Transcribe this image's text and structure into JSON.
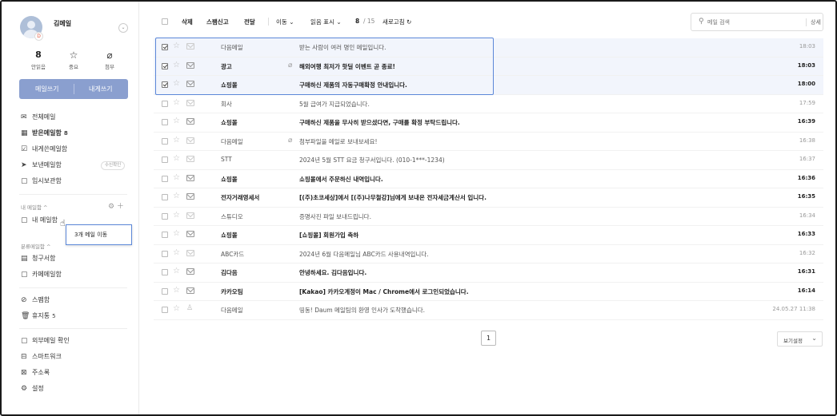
{
  "profile": {
    "name": "김메일",
    "toggle_icon": "chevron-down-icon"
  },
  "stats": [
    {
      "value": "8",
      "label": "안읽음"
    },
    {
      "icon": "☆",
      "label": "중요"
    },
    {
      "icon": "⌀",
      "label": "첨부"
    }
  ],
  "compose": {
    "write": "메일쓰기",
    "write_self": "내게쓰기"
  },
  "nav": [
    {
      "icon": "✉",
      "label": "전체메일"
    },
    {
      "icon": "▦",
      "label": "받은메일함",
      "badge": "8"
    },
    {
      "icon": "☑",
      "label": "내게쓴메일함"
    },
    {
      "icon": "➤",
      "label": "보낸메일함",
      "pill": "수신확인"
    },
    {
      "icon": "▢",
      "label": "임시보관함"
    }
  ],
  "my_folders": {
    "header": "내 메일함 ^",
    "items": [
      {
        "label": "내 메일함"
      }
    ]
  },
  "category_folders": {
    "header": "분류메일함 ^",
    "items": [
      {
        "label": "청구서함"
      },
      {
        "label": "카페메일함"
      }
    ]
  },
  "other_nav": [
    {
      "label": "스팸함"
    },
    {
      "label": "휴지통",
      "badge": "5"
    }
  ],
  "tool_nav": [
    {
      "label": "외부메일 확인"
    },
    {
      "label": "스마트워크"
    },
    {
      "label": "주소록"
    },
    {
      "label": "설정"
    }
  ],
  "drag_tooltip": "3개 메일 이동",
  "toolbar": {
    "delete": "삭제",
    "spam": "스팸신고",
    "forward": "전달",
    "move": "이동",
    "read_display": "읽음 표시",
    "count": "8",
    "total": "/ 15",
    "refresh": "새로고침",
    "search_placeholder": "메일 검색",
    "advanced": "상세"
  },
  "emails": [
    {
      "sender": "다음메일",
      "subject": "받는 사람이 여러 명인 메일입니다.",
      "time": "18:03",
      "selected": true,
      "unread": false,
      "attach": false
    },
    {
      "sender": "광고",
      "subject": "해외여행 최저가 핫딜 이벤트 곧 종료!",
      "time": "18:03",
      "selected": true,
      "unread": true,
      "attach": true
    },
    {
      "sender": "쇼핑몰",
      "subject": "구매하신 제품의 자동구매확정 안내입니다.",
      "time": "18:00",
      "selected": true,
      "unread": true,
      "attach": false
    },
    {
      "sender": "회사",
      "subject": "5월 급여가 지급되었습니다.",
      "time": "17:59",
      "selected": false,
      "unread": false,
      "attach": false
    },
    {
      "sender": "쇼핑몰",
      "subject": "구매하신 제품을 무사히 받으셨다면, 구매를 확정 부탁드립니다.",
      "time": "16:39",
      "selected": false,
      "unread": true,
      "attach": false
    },
    {
      "sender": "다음메일",
      "subject": "첨부파일을 메일로 보내보세요!",
      "time": "16:38",
      "selected": false,
      "unread": false,
      "attach": true
    },
    {
      "sender": "STT",
      "subject": "2024년 5월 STT 요금 청구서입니다. (010-1***-1234)",
      "time": "16:37",
      "selected": false,
      "unread": false,
      "attach": false
    },
    {
      "sender": "쇼핑몰",
      "subject": "쇼핑몰에서 주문하신 내역입니다.",
      "time": "16:36",
      "selected": false,
      "unread": true,
      "attach": false
    },
    {
      "sender": "전자거래영세서",
      "subject": "[(주)초코세상]에서 [(주)나무철강]님에게 보내온 전자세금계산서 입니다.",
      "time": "16:35",
      "selected": false,
      "unread": true,
      "attach": false
    },
    {
      "sender": "스튜디오",
      "subject": "증명사진 파일 보내드립니다.",
      "time": "16:34",
      "selected": false,
      "unread": false,
      "attach": false
    },
    {
      "sender": "쇼핑몰",
      "subject": "[쇼핑몰] 회원가입 축하",
      "time": "16:33",
      "selected": false,
      "unread": true,
      "attach": false
    },
    {
      "sender": "ABC카드",
      "subject": "2024년 6월 다음메일님 ABC카드 사용내역입니다.",
      "time": "16:32",
      "selected": false,
      "unread": false,
      "attach": false
    },
    {
      "sender": "김다음",
      "subject": "안녕하세요. 김다음입니다.",
      "time": "16:31",
      "selected": false,
      "unread": true,
      "attach": false
    },
    {
      "sender": "카카오팀",
      "subject": "[Kakao] 카카오계정이 Mac / Chrome에서 로그인되었습니다.",
      "time": "16:14",
      "selected": false,
      "unread": true,
      "attach": false
    },
    {
      "sender": "다음메일",
      "subject": "띵동! Daum 메일팀의 환영 인사가 도착했습니다.",
      "time": "24.05.27 11:38",
      "selected": false,
      "unread": false,
      "attach": false,
      "person": true
    }
  ],
  "pagination": {
    "current": "1"
  },
  "view_settings": "보기설정"
}
